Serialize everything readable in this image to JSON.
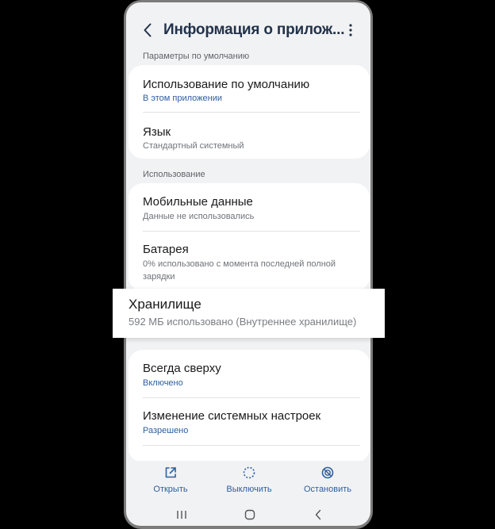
{
  "header": {
    "title": "Информация о прилож..."
  },
  "sections": {
    "defaults": {
      "label": "Параметры по умолчанию"
    },
    "usage": {
      "label": "Использование"
    }
  },
  "defaults_card": {
    "items": [
      {
        "title": "Использование по умолчанию",
        "subtitle": "В этом приложении"
      },
      {
        "title": "Язык",
        "subtitle": "Стандартный системный"
      }
    ]
  },
  "usage_card": {
    "items": [
      {
        "title": "Мобильные данные",
        "subtitle": "Данные не использовались"
      },
      {
        "title": "Батарея",
        "subtitle": "0% использовано с момента последней полной зарядки"
      }
    ]
  },
  "storage_highlight": {
    "title": "Хранилище",
    "subtitle": "592 МБ использовано (Внутреннее хранилище)"
  },
  "advanced_card": {
    "items": [
      {
        "title": "Всегда сверху",
        "subtitle": "Включено"
      },
      {
        "title": "Изменение системных настроек",
        "subtitle": "Разрешено"
      }
    ]
  },
  "bottom_actions": [
    {
      "label": "Открыть",
      "icon": "open-external-icon"
    },
    {
      "label": "Выключить",
      "icon": "disable-icon"
    },
    {
      "label": "Остановить",
      "icon": "stop-icon"
    }
  ],
  "colors": {
    "accent": "#2e5f9e",
    "title": "#22324a",
    "background": "#f1f2f4"
  }
}
